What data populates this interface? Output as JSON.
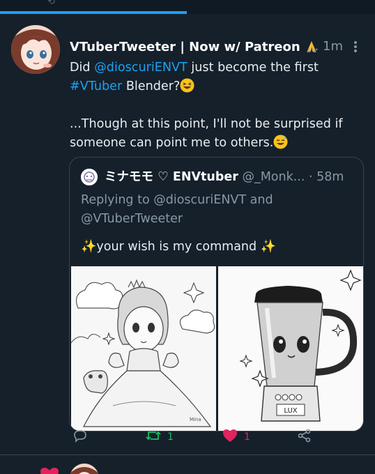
{
  "tweet": {
    "author_name": "VTuberTweeter | Now w/ Patreon",
    "overflow": "...",
    "time": "1m",
    "body_lines": [
      "Did",
      "@dioscuriENVT",
      "just become the first",
      "#VTuber",
      "Blender?",
      "...Though at this point, I'll not be surprised if",
      "someone can point me to others."
    ]
  },
  "quoted": {
    "author_name": "ミナモモ ♡ ENVtuber",
    "handle": "@_Monk...",
    "time": "· 58m",
    "replying_line1": "Replying to @dioscuriENVT and",
    "replying_line2": "@VTuberTweeter",
    "text": "your wish is my command",
    "blender_label": "LUX",
    "signature": "Mina"
  },
  "actions": {
    "retweet_count": "1",
    "like_count": "1"
  },
  "colors": {
    "background": "#15202b",
    "link": "#1da1f2",
    "muted": "#8899a6",
    "retweet": "#17bf63",
    "like": "#e0245e",
    "border": "#38444d"
  }
}
